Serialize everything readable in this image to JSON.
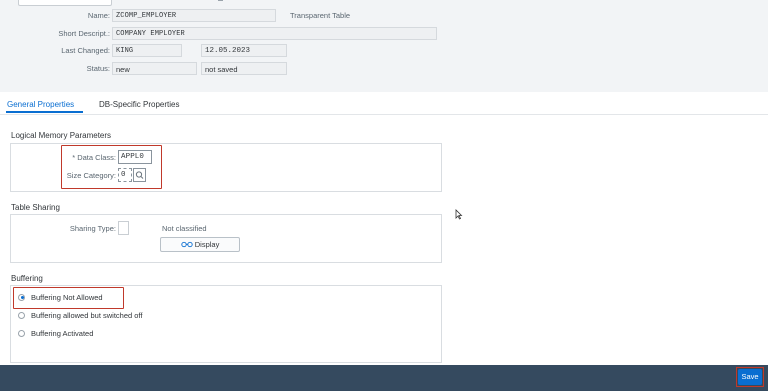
{
  "header": {
    "name_label": "Name:",
    "name_value": "ZCOMP_EMPLOYER",
    "table_type": "Transparent Table",
    "short_desc_label": "Short Descript.:",
    "short_desc_value": "COMPANY EMPLOYER",
    "last_changed_label": "Last Changed:",
    "last_changed_user": "KING",
    "last_changed_date": "12.05.2023",
    "status_label": "Status:",
    "status_value": "new",
    "status_save": "not saved"
  },
  "tabs": [
    {
      "label": "General Properties",
      "active": true
    },
    {
      "label": "DB-Specific Properties",
      "active": false
    }
  ],
  "logical_memory": {
    "title": "Logical Memory Parameters",
    "data_class_label": "* Data Class:",
    "data_class_value": "APPL0",
    "size_category_label": "Size Category:",
    "size_category_value": "0",
    "search_icon": "search-icon"
  },
  "table_sharing": {
    "title": "Table Sharing",
    "sharing_type_label": "Sharing Type:",
    "sharing_type_value": "",
    "classification": "Not classified",
    "display_button": "Display",
    "display_icon": "glasses-icon"
  },
  "buffering": {
    "title": "Buffering",
    "options": [
      {
        "label": "Buffering Not Allowed",
        "selected": true
      },
      {
        "label": "Buffering allowed but switched off",
        "selected": false
      },
      {
        "label": "Buffering Activated",
        "selected": false
      }
    ]
  },
  "footer": {
    "save_label": "Save"
  },
  "colors": {
    "accent": "#0a6ed1",
    "footer_bg": "#354a5f",
    "highlight": "#c0392b"
  }
}
